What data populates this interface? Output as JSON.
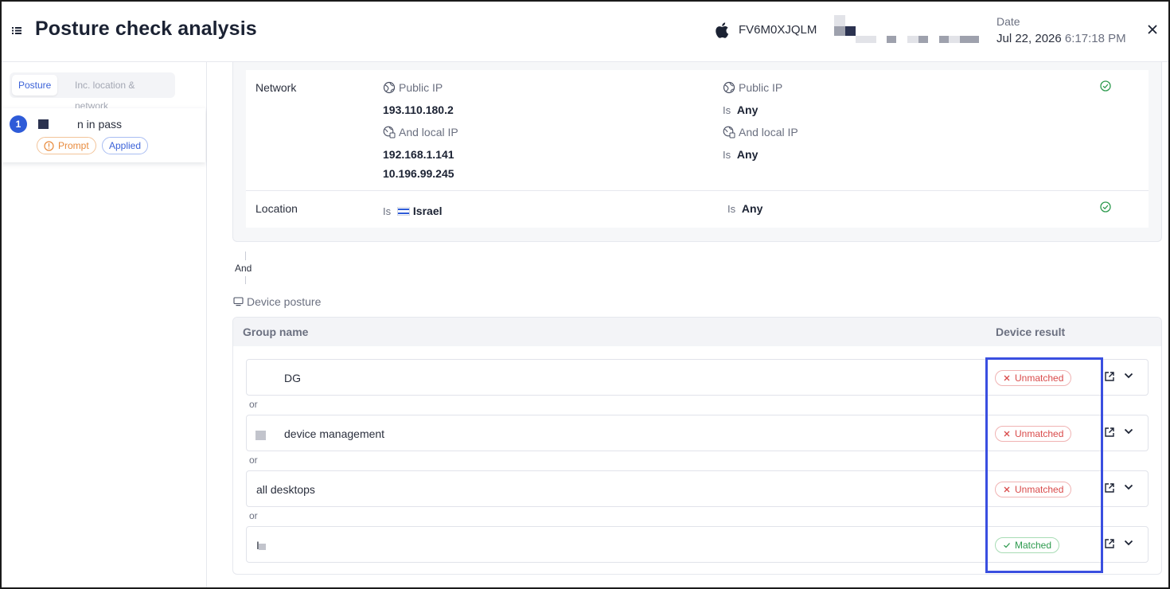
{
  "header": {
    "title": "Posture check analysis",
    "device_icon": "apple-icon",
    "device_id": "FV6M0XJQLM",
    "date_label": "Date",
    "date": "Jul 22, 2026",
    "time": "6:17:18 PM"
  },
  "sidebar": {
    "tabs": [
      "Posture",
      "Inc. location & network"
    ],
    "policy": {
      "number": "1",
      "name": "n in pass",
      "action": "Prompt",
      "status": "Applied"
    }
  },
  "conditions": {
    "network": {
      "label": "Network",
      "device_public_ip_label": "Public IP",
      "device_public_ip": "193.110.180.2",
      "device_local_ip_label": "And local IP",
      "device_local_ips": [
        "192.168.1.141",
        "10.196.99.245"
      ],
      "rule_public_ip_label": "Public IP",
      "rule_is": "Is",
      "rule_public_ip_value": "Any",
      "rule_local_ip_label": "And local IP",
      "rule_local_ip_value": "Any"
    },
    "location": {
      "label": "Location",
      "device_is": "Is",
      "device_value": "Israel",
      "rule_is": "Is",
      "rule_value": "Any"
    }
  },
  "connector": "And",
  "device_posture": {
    "title": "Device posture",
    "columns": {
      "group_name": "Group name",
      "device_result": "Device result"
    },
    "or_label": "or",
    "groups": [
      {
        "name": "DG",
        "result": "Unmatched"
      },
      {
        "name": "device management",
        "result": "Unmatched"
      },
      {
        "name": "all desktops",
        "result": "Unmatched"
      },
      {
        "name": "I",
        "result": "Matched"
      }
    ]
  },
  "colors": {
    "accent": "#2e5bd8",
    "unmatched": "#d94a4a",
    "matched": "#2d9a4e",
    "prompt": "#e88a3c",
    "highlight": "#3a4fe0"
  }
}
